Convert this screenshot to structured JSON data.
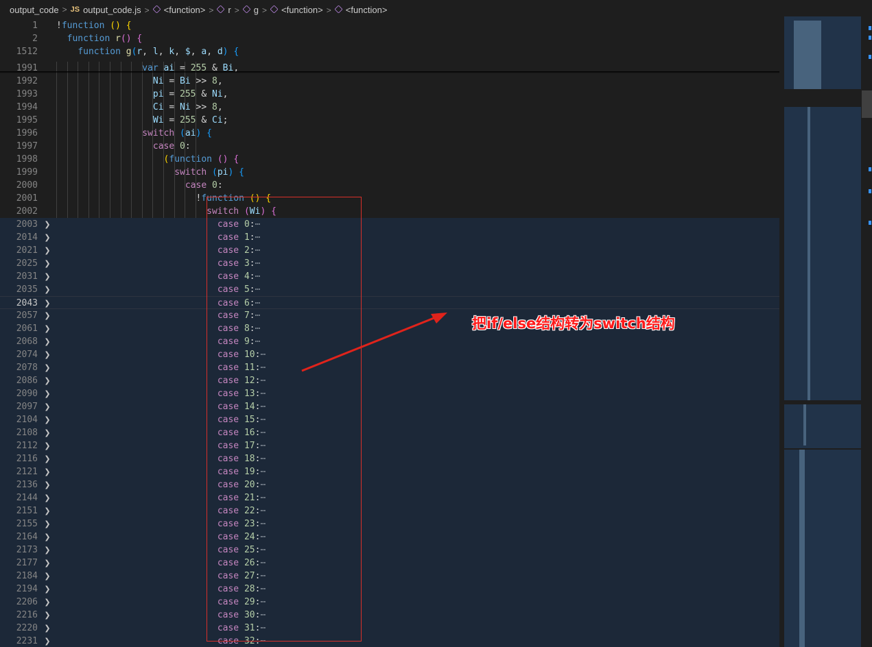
{
  "breadcrumb": {
    "folder": "output_code",
    "file_badge": "JS",
    "file": "output_code.js",
    "symbols": [
      "<function>",
      "r",
      "g",
      "<function>",
      "<function>"
    ]
  },
  "sticky_lines": [
    {
      "ln": "1",
      "tokens": [
        [
          "op",
          "!"
        ],
        [
          "kw",
          "function"
        ],
        [
          "op",
          " "
        ],
        [
          "br1",
          "()"
        ],
        [
          "op",
          " "
        ],
        [
          "br1",
          "{"
        ]
      ]
    },
    {
      "ln": "2",
      "tokens": [
        [
          "op",
          "  "
        ],
        [
          "kw",
          "function"
        ],
        [
          "op",
          " "
        ],
        [
          "fn",
          "r"
        ],
        [
          "br2",
          "()"
        ],
        [
          "op",
          " "
        ],
        [
          "br2",
          "{"
        ]
      ]
    },
    {
      "ln": "1512",
      "tokens": [
        [
          "op",
          "    "
        ],
        [
          "kw",
          "function"
        ],
        [
          "op",
          " "
        ],
        [
          "fn",
          "g"
        ],
        [
          "br3",
          "("
        ],
        [
          "var",
          "r"
        ],
        [
          "op",
          ", "
        ],
        [
          "var",
          "l"
        ],
        [
          "op",
          ", "
        ],
        [
          "var",
          "k"
        ],
        [
          "op",
          ", "
        ],
        [
          "var",
          "$"
        ],
        [
          "op",
          ", "
        ],
        [
          "var",
          "a"
        ],
        [
          "op",
          ", "
        ],
        [
          "var",
          "d"
        ],
        [
          "br3",
          ")"
        ],
        [
          "op",
          " "
        ],
        [
          "br3",
          "{"
        ]
      ]
    }
  ],
  "lines": [
    {
      "ln": "1991",
      "tokens": [
        [
          "op",
          "                "
        ],
        [
          "kw",
          "var"
        ],
        [
          "op",
          " "
        ],
        [
          "var",
          "ai"
        ],
        [
          "op",
          " = "
        ],
        [
          "num",
          "255"
        ],
        [
          "op",
          " & "
        ],
        [
          "var",
          "Bi"
        ],
        [
          "op",
          ","
        ]
      ]
    },
    {
      "ln": "1992",
      "tokens": [
        [
          "op",
          "                  "
        ],
        [
          "var",
          "Ni"
        ],
        [
          "op",
          " = "
        ],
        [
          "var",
          "Bi"
        ],
        [
          "op",
          " >> "
        ],
        [
          "num",
          "8"
        ],
        [
          "op",
          ","
        ]
      ]
    },
    {
      "ln": "1993",
      "tokens": [
        [
          "op",
          "                  "
        ],
        [
          "var",
          "pi"
        ],
        [
          "op",
          " = "
        ],
        [
          "num",
          "255"
        ],
        [
          "op",
          " & "
        ],
        [
          "var",
          "Ni"
        ],
        [
          "op",
          ","
        ]
      ]
    },
    {
      "ln": "1994",
      "tokens": [
        [
          "op",
          "                  "
        ],
        [
          "var",
          "Ci"
        ],
        [
          "op",
          " = "
        ],
        [
          "var",
          "Ni"
        ],
        [
          "op",
          " >> "
        ],
        [
          "num",
          "8"
        ],
        [
          "op",
          ","
        ]
      ]
    },
    {
      "ln": "1995",
      "tokens": [
        [
          "op",
          "                  "
        ],
        [
          "var",
          "Wi"
        ],
        [
          "op",
          " = "
        ],
        [
          "num",
          "255"
        ],
        [
          "op",
          " & "
        ],
        [
          "var",
          "Ci"
        ],
        [
          "op",
          ";"
        ]
      ]
    },
    {
      "ln": "1996",
      "tokens": [
        [
          "op",
          "                "
        ],
        [
          "ctl",
          "switch"
        ],
        [
          "op",
          " "
        ],
        [
          "br3",
          "("
        ],
        [
          "var",
          "ai"
        ],
        [
          "br3",
          ")"
        ],
        [
          "op",
          " "
        ],
        [
          "br3",
          "{"
        ]
      ]
    },
    {
      "ln": "1997",
      "tokens": [
        [
          "op",
          "                  "
        ],
        [
          "ctl",
          "case"
        ],
        [
          "op",
          " "
        ],
        [
          "num",
          "0"
        ],
        [
          "op",
          ":"
        ]
      ]
    },
    {
      "ln": "1998",
      "tokens": [
        [
          "op",
          "                    "
        ],
        [
          "br1",
          "("
        ],
        [
          "kw",
          "function"
        ],
        [
          "op",
          " "
        ],
        [
          "br2",
          "()"
        ],
        [
          "op",
          " "
        ],
        [
          "br2",
          "{"
        ]
      ]
    },
    {
      "ln": "1999",
      "tokens": [
        [
          "op",
          "                      "
        ],
        [
          "ctl",
          "switch"
        ],
        [
          "op",
          " "
        ],
        [
          "br3",
          "("
        ],
        [
          "var",
          "pi"
        ],
        [
          "br3",
          ")"
        ],
        [
          "op",
          " "
        ],
        [
          "br3",
          "{"
        ]
      ]
    },
    {
      "ln": "2000",
      "tokens": [
        [
          "op",
          "                        "
        ],
        [
          "ctl",
          "case"
        ],
        [
          "op",
          " "
        ],
        [
          "num",
          "0"
        ],
        [
          "op",
          ":"
        ]
      ]
    },
    {
      "ln": "2001",
      "tokens": [
        [
          "op",
          "                          !"
        ],
        [
          "kw",
          "function"
        ],
        [
          "op",
          " "
        ],
        [
          "br1",
          "()"
        ],
        [
          "op",
          " "
        ],
        [
          "br1",
          "{"
        ]
      ]
    },
    {
      "ln": "2002",
      "tokens": [
        [
          "op",
          "                            "
        ],
        [
          "ctl",
          "switch"
        ],
        [
          "op",
          " "
        ],
        [
          "br2",
          "("
        ],
        [
          "var",
          "Wi"
        ],
        [
          "br2",
          ")"
        ],
        [
          "op",
          " "
        ],
        [
          "br2",
          "{"
        ]
      ]
    }
  ],
  "fold_lines": [
    [
      "2003",
      "0"
    ],
    [
      "2014",
      "1"
    ],
    [
      "2021",
      "2"
    ],
    [
      "2025",
      "3"
    ],
    [
      "2031",
      "4"
    ],
    [
      "2035",
      "5"
    ],
    [
      "2043",
      "6"
    ],
    [
      "2057",
      "7"
    ],
    [
      "2061",
      "8"
    ],
    [
      "2068",
      "9"
    ],
    [
      "2074",
      "10"
    ],
    [
      "2078",
      "11"
    ],
    [
      "2086",
      "12"
    ],
    [
      "2090",
      "13"
    ],
    [
      "2097",
      "14"
    ],
    [
      "2104",
      "15"
    ],
    [
      "2108",
      "16"
    ],
    [
      "2112",
      "17"
    ],
    [
      "2116",
      "18"
    ],
    [
      "2121",
      "19"
    ],
    [
      "2136",
      "20"
    ],
    [
      "2144",
      "21"
    ],
    [
      "2151",
      "22"
    ],
    [
      "2155",
      "23"
    ],
    [
      "2164",
      "24"
    ],
    [
      "2173",
      "25"
    ],
    [
      "2177",
      "26"
    ],
    [
      "2184",
      "27"
    ],
    [
      "2194",
      "28"
    ],
    [
      "2206",
      "29"
    ],
    [
      "2216",
      "30"
    ],
    [
      "2220",
      "31"
    ],
    [
      "2231",
      "32"
    ]
  ],
  "case_keyword": "case",
  "collapsed_marker": "⋯",
  "active_line": "2043",
  "annotation": {
    "text": "把if/else结构转为switch结构",
    "color": "#ff1a1a"
  },
  "icons": {
    "breadcrumb_separator": "chevron-right-icon",
    "symbol": "symbol-method-icon",
    "fold": "chevron-right-icon"
  }
}
